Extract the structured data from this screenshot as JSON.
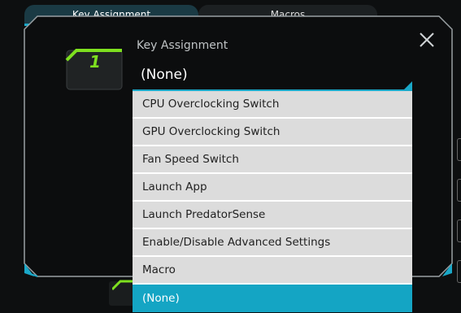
{
  "tabs": [
    {
      "label": "Key Assignment",
      "active": true
    },
    {
      "label": "Macros",
      "active": false
    }
  ],
  "dialog": {
    "key_label": "1",
    "title": "Key Assignment",
    "selected_value": "(None)",
    "close_icon": "close-icon",
    "accent_color": "#1aa8c8",
    "key_accent_color": "#7ee01f"
  },
  "dropdown": {
    "options": [
      "CPU Overclocking Switch",
      "GPU Overclocking Switch",
      "Fan Speed Switch",
      "Launch App",
      "Launch PredatorSense",
      "Enable/Disable Advanced Settings",
      "Macro",
      "(None)"
    ],
    "selected_index": 7,
    "highlight_color": "#14a5c4"
  }
}
